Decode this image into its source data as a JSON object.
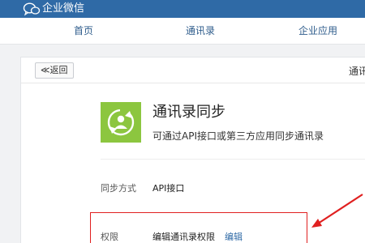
{
  "topbar": {
    "app_title": "企业微信",
    "logo_icon": "chat-bubbles-icon",
    "bg_color": "#2f6aa6"
  },
  "nav": {
    "items": [
      {
        "label": "首页"
      },
      {
        "label": "通讯录"
      },
      {
        "label": "企业应用"
      }
    ]
  },
  "card": {
    "back_label": "≪返回",
    "header_right": "通讯",
    "app": {
      "icon": "sync-contacts-icon",
      "icon_color": "#8cc63f",
      "title": "通讯录同步",
      "description": "可通过API接口或第三方应用同步通讯录"
    },
    "rows": {
      "sync_method": {
        "label": "同步方式",
        "value": "API接口"
      },
      "permission": {
        "label": "权限",
        "value": "编辑通讯录权限",
        "action": "编辑"
      }
    }
  },
  "annotation": {
    "highlight_color": "#e02020"
  }
}
